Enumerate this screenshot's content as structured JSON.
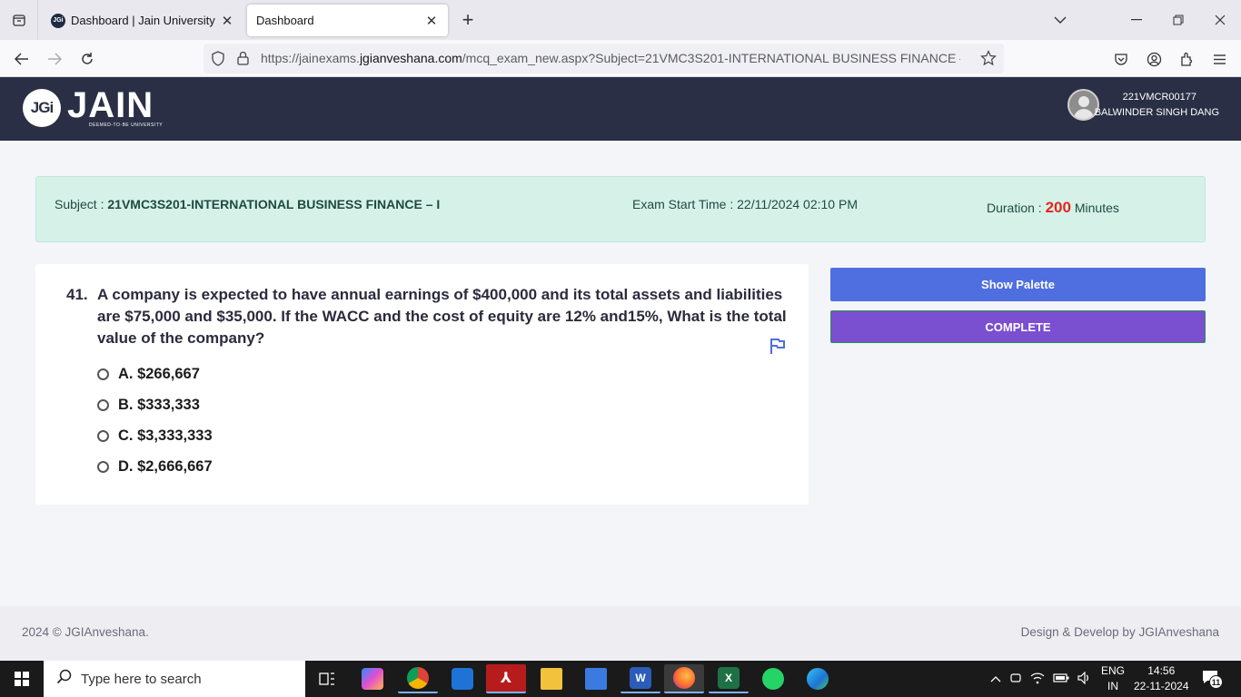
{
  "browser": {
    "tabs": [
      {
        "title": "Dashboard | Jain University",
        "favicon": "JGi",
        "active": false
      },
      {
        "title": "Dashboard",
        "active": true
      }
    ],
    "url_prefix": "https://jainexams.",
    "url_domain": "jgianveshana.com",
    "url_suffix": "/mcq_exam_new.aspx?Subject=21VMC3S201-INTERNATIONAL BUSINESS FINANCE – I"
  },
  "header": {
    "logo_mark": "JGi",
    "logo_word": "JAIN",
    "logo_sub": "DEEMED-TO-BE UNIVERSITY",
    "user_id": "221VMCR00177",
    "user_name": "BALWINDER SINGH DANG"
  },
  "exam": {
    "subject_label": "Subject : ",
    "subject_value": "21VMC3S201-INTERNATIONAL BUSINESS FINANCE – I",
    "start_label": "Exam Start Time : ",
    "start_value": "22/11/2024 02:10 PM",
    "duration_label": "Duration : ",
    "duration_value": "200",
    "duration_unit": " Minutes"
  },
  "question": {
    "number": "41.",
    "text": "A company is expected to have annual earnings of $400,000 and its total assets and liabilities are $75,000 and $35,000. If the WACC and the cost of equity are 12% and15%, What is the total value of the company?",
    "options": [
      {
        "label": "A. $266,667"
      },
      {
        "label": "B. $333,333"
      },
      {
        "label": "C. $3,333,333"
      },
      {
        "label": "D. $2,666,667"
      }
    ]
  },
  "actions": {
    "show_palette": "Show Palette",
    "complete": "COMPLETE"
  },
  "footer": {
    "left": "2024 © JGIAnveshana.",
    "right": "Design & Develop by JGIAnveshana"
  },
  "taskbar": {
    "search_placeholder": "Type here to search",
    "lang_top": "ENG",
    "lang_bottom": "IN",
    "time": "14:56",
    "date": "22-11-2024",
    "notification_count": "11"
  }
}
